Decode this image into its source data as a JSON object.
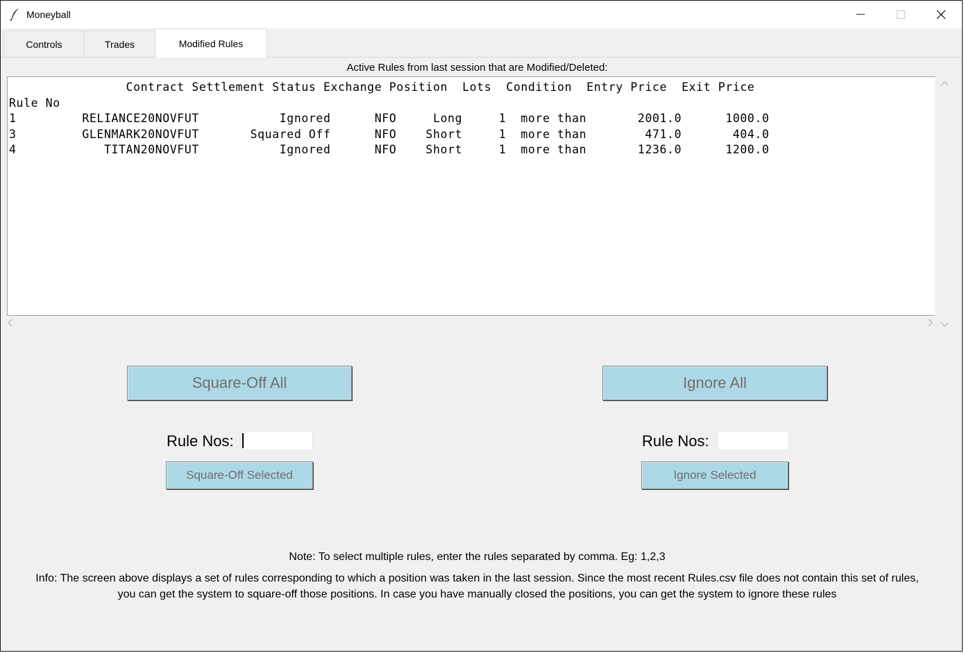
{
  "window": {
    "title": "Moneyball"
  },
  "tabs": [
    {
      "label": "Controls",
      "active": false
    },
    {
      "label": "Trades",
      "active": false
    },
    {
      "label": "Modified Rules",
      "active": true
    }
  ],
  "rules_panel": {
    "heading": "Active Rules from last session that are Modified/Deleted:",
    "table_text": "                Contract Settlement Status Exchange Position  Lots  Condition  Entry Price  Exit Price\nRule No\n1         RELIANCE20NOVFUT           Ignored      NFO     Long     1  more than       2001.0      1000.0\n3         GLENMARK20NOVFUT       Squared Off      NFO    Short     1  more than        471.0       404.0\n4            TITAN20NOVFUT           Ignored      NFO    Short     1  more than       1236.0      1200.0",
    "columns": [
      "Contract",
      "Settlement Status",
      "Exchange",
      "Position",
      "Lots",
      "Condition",
      "Entry Price",
      "Exit Price"
    ],
    "index_label": "Rule No",
    "rows": [
      {
        "rule_no": "1",
        "contract": "RELIANCE20NOVFUT",
        "status": "Ignored",
        "exchange": "NFO",
        "position": "Long",
        "lots": "1",
        "condition": "more than",
        "entry_price": "2001.0",
        "exit_price": "1000.0"
      },
      {
        "rule_no": "3",
        "contract": "GLENMARK20NOVFUT",
        "status": "Squared Off",
        "exchange": "NFO",
        "position": "Short",
        "lots": "1",
        "condition": "more than",
        "entry_price": "471.0",
        "exit_price": "404.0"
      },
      {
        "rule_no": "4",
        "contract": "TITAN20NOVFUT",
        "status": "Ignored",
        "exchange": "NFO",
        "position": "Short",
        "lots": "1",
        "condition": "more than",
        "entry_price": "1236.0",
        "exit_price": "1200.0"
      }
    ]
  },
  "left_panel": {
    "square_off_all": "Square-Off All",
    "rule_nos_label": "Rule Nos:",
    "rule_nos_value": "",
    "square_off_selected": "Square-Off Selected"
  },
  "right_panel": {
    "ignore_all": "Ignore All",
    "rule_nos_label": "Rule Nos:",
    "rule_nos_value": "",
    "ignore_selected": "Ignore Selected"
  },
  "note": "Note: To select multiple rules, enter the rules separated by comma. Eg: 1,2,3",
  "info": "Info: The screen above displays a set of rules corresponding to which a position was taken in the last session. Since the most recent Rules.csv file does not contain this set of rules, you  can get the system to square-off those positions. In case you have manually closed the positions, you can get the system to ignore these rules",
  "colors": {
    "button_bg": "#add8e6",
    "button_text": "#6f6f6f",
    "window_bg": "#f0f0f0"
  },
  "icons": {
    "app": "feather-icon",
    "minimize": "minimize-icon",
    "maximize": "maximize-icon",
    "close": "close-icon"
  }
}
